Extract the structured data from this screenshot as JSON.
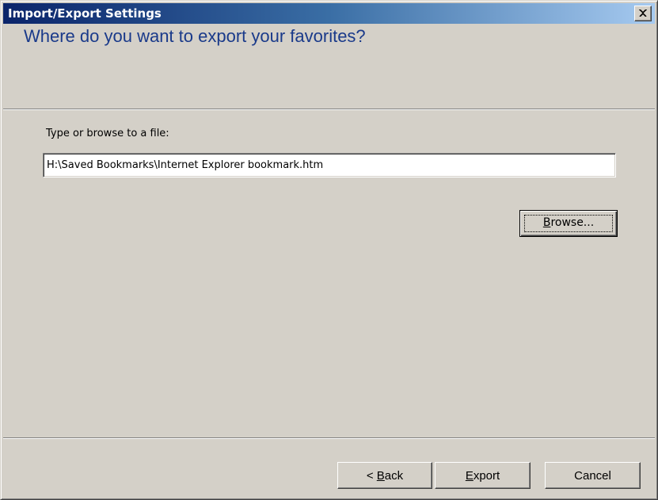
{
  "window": {
    "title": "Import/Export Settings",
    "close_label": "Close"
  },
  "header": {
    "title": "Where do you want to export your favorites?"
  },
  "form": {
    "prompt_label": "Type or browse to a file:",
    "file_path_value": "H:\\Saved Bookmarks\\Internet Explorer bookmark.htm",
    "browse": {
      "accel": "B",
      "rest": "rowse..."
    }
  },
  "footer": {
    "back": {
      "prefix": "< ",
      "accel": "B",
      "rest": "ack"
    },
    "export": {
      "accel": "E",
      "rest": "xport"
    },
    "cancel_label": "Cancel"
  },
  "colors": {
    "title_gradient_start": "#0a246a",
    "title_gradient_end": "#a6caf0",
    "header_text": "#1a3a8a",
    "face": "#d4d0c8"
  },
  "icons": {
    "close": "close-icon"
  }
}
